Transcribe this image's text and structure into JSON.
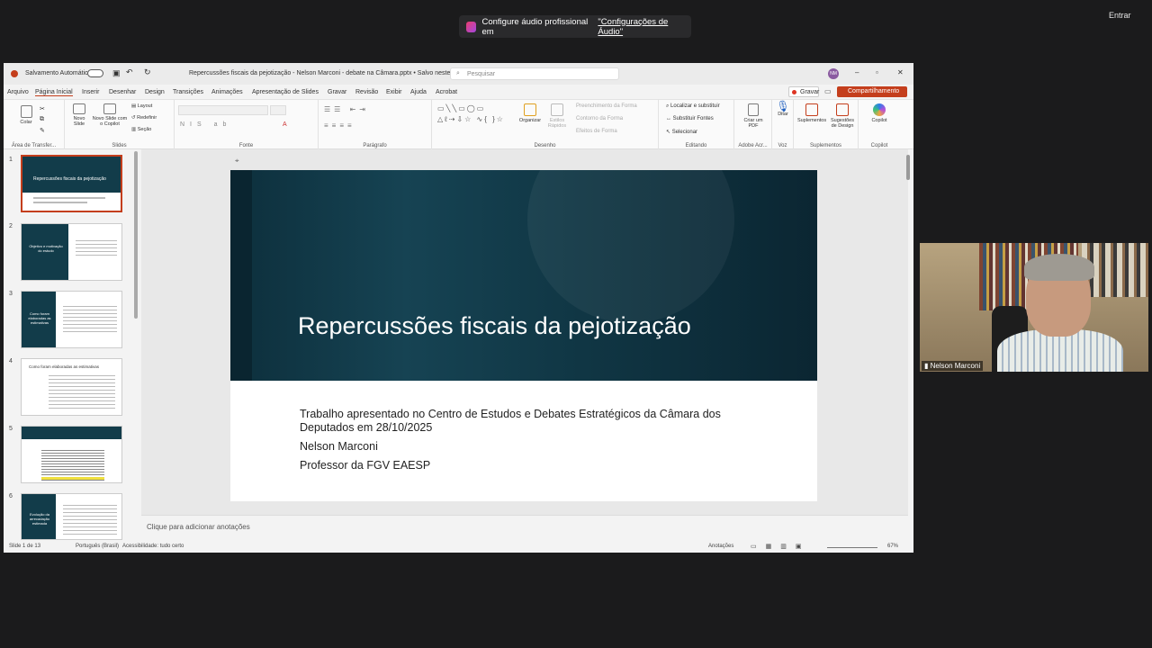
{
  "toast": {
    "text": "Configure áudio profissional em ",
    "link": "\"Configurações de Áudio\""
  },
  "meeting": {
    "enter_label": "Entrar"
  },
  "titlebar": {
    "autosave": "Salvamento Automático",
    "doc_title": "Repercussões fiscais da pejotização - Nelson Marconi - debate na Câmara.pptx • Salvo neste PC",
    "search_placeholder": "Pesquisar",
    "avatar": "NM"
  },
  "menu": [
    "Arquivo",
    "Página Inicial",
    "Inserir",
    "Desenhar",
    "Design",
    "Transições",
    "Animações",
    "Apresentação de Slides",
    "Gravar",
    "Revisão",
    "Exibir",
    "Ajuda",
    "Acrobat"
  ],
  "menu_right": {
    "record": "Gravar",
    "share": "Compartilhamento"
  },
  "ribbon": {
    "groups": [
      "Área de Transfer...",
      "Slides",
      "Fonte",
      "Parágrafo",
      "Desenho",
      "Editando",
      "Adobe Acr...",
      "Voz",
      "Suplementos",
      "Copilot"
    ],
    "clipboard": {
      "paste": "Colar"
    },
    "slides": {
      "new": "Novo Slide",
      "new_copilot": "Novo Slide com o Copilot",
      "layout": "Layout",
      "reset": "Redefinir",
      "section": "Seção"
    },
    "drawing": {
      "arrange": "Organizar",
      "styles": "Estilos Rápidos",
      "fill": "Preenchimento da Forma",
      "outline": "Contorno da Forma",
      "effects": "Efeitos de Forma"
    },
    "editing": {
      "find": "Localizar e substituir",
      "replace": "Substituir Fontes",
      "select": "Selecionar"
    },
    "adobe": {
      "pdf": "Criar um PDF"
    },
    "voice": {
      "dictate": "Ditar"
    },
    "addins": {
      "addins": "Suplementos",
      "design": "Sugestões de Design"
    },
    "copilot": {
      "label": "Copilot"
    }
  },
  "thumbnails": [
    {
      "num": "1",
      "title": "Repercussões fiscais da pejotização"
    },
    {
      "num": "2",
      "title": "Objetivo e motivação do estudo"
    },
    {
      "num": "3",
      "title": "Como foram elaboradas as estimativas"
    },
    {
      "num": "4",
      "title": "Como foram elaboradas as estimativas"
    },
    {
      "num": "5",
      "title": ""
    },
    {
      "num": "6",
      "title": "Evolução da arrecadação estimada"
    }
  ],
  "slide": {
    "title": "Repercussões fiscais da pejotização",
    "lines": [
      "Trabalho apresentado no Centro de Estudos e Debates Estratégicos da Câmara dos Deputados em 28/10/2025",
      "Nelson Marconi",
      "Professor da FGV EAESP"
    ]
  },
  "notes_placeholder": "Clique para adicionar anotações",
  "status": {
    "slide": "Slide 1 de 13",
    "lang": "Português (Brasil)",
    "access": "Acessibilidade: tudo certo",
    "notes": "Anotações",
    "zoom": "67%"
  },
  "video": {
    "name": "Nelson Marconi"
  }
}
